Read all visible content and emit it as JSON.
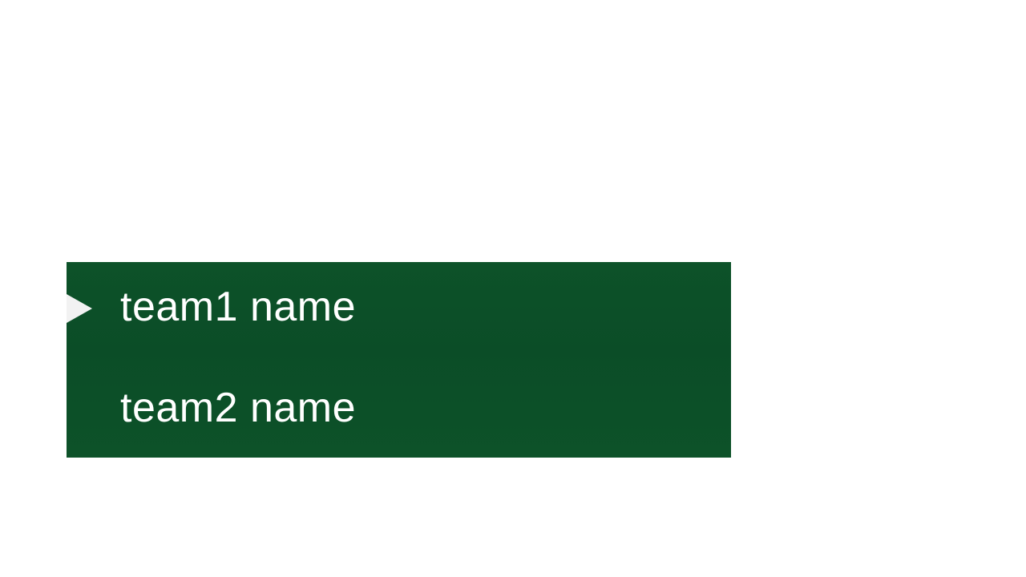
{
  "scoreboard": {
    "accent_color": "#0b4d27",
    "text_color": "#ffffff",
    "teams": [
      {
        "name": "team1 name",
        "selected": true,
        "indicator_icon": "play-arrow-icon"
      },
      {
        "name": "team2 name",
        "selected": false
      }
    ]
  }
}
